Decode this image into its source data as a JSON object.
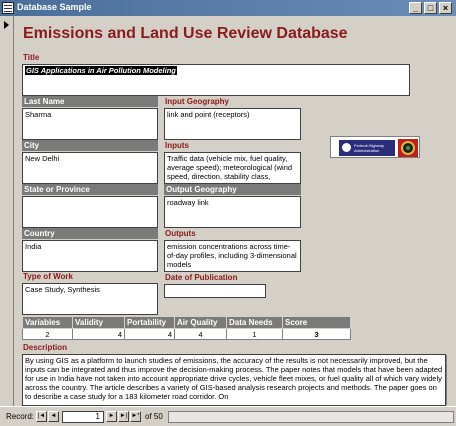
{
  "window": {
    "title": "Database Sample",
    "controls": {
      "minimize": "_",
      "maximize": "□",
      "close": "×"
    }
  },
  "form": {
    "heading": "Emissions and Land Use Review Database",
    "title": {
      "label": "Title",
      "value": "GIS Applications in Air Pollution Modeling"
    },
    "last_name": {
      "label": "Last Name",
      "value": "Sharma"
    },
    "city": {
      "label": "City",
      "value": "New Delhi"
    },
    "state": {
      "label": "State or Province",
      "value": ""
    },
    "country": {
      "label": "Country",
      "value": "India"
    },
    "type_of_work": {
      "label": "Type of Work",
      "value": "Case Study, Synthesis"
    },
    "input_geography": {
      "label": "Input Geography",
      "value": "link and point (receptors)"
    },
    "inputs": {
      "label": "Inputs",
      "value": "Traffic data (vehicle mix, fuel quality, average speed); meteorological (wind speed, direction, stability class,"
    },
    "output_geography": {
      "label": "Output Geography",
      "value": "roadway link"
    },
    "outputs": {
      "label": "Outputs",
      "value": "emission concentrations across time-of-day profiles, including 3-dimensional models"
    },
    "date_of_publication": {
      "label": "Date of Publication",
      "value": ""
    },
    "scores": {
      "headers": [
        "Variables",
        "Validity",
        "Portability",
        "Air Quality",
        "Data Needs",
        "Score"
      ],
      "values": [
        "2",
        "4",
        "4",
        "4",
        "1",
        "3"
      ]
    },
    "description": {
      "label": "Description",
      "value": "By using GIS as a platform to launch studies of emissions, the accuracy of the results is not necessarily improved, but the inputs can be integrated and thus improve the decision-making process. The paper notes that models that have been adapted for use in India have not taken into account appropriate drive cycles, vehicle fleet mixes, or fuel quality all of which vary widely across the country. The article describes a variety of GIS-based analysis research projects and methods. The paper goes on to describe a case study for a 183 kilometer road corridor. On"
    },
    "logos": {
      "left": "fhwa-logo",
      "right": "dot-seal-logo",
      "left_text": "Federal Highway Administration"
    }
  },
  "navigation": {
    "record_label": "Record:",
    "current_record": "1",
    "of_label": "of 50",
    "buttons": {
      "first": "|◄",
      "prev": "◄",
      "next": "►",
      "last": "►|",
      "new": "►*"
    }
  }
}
